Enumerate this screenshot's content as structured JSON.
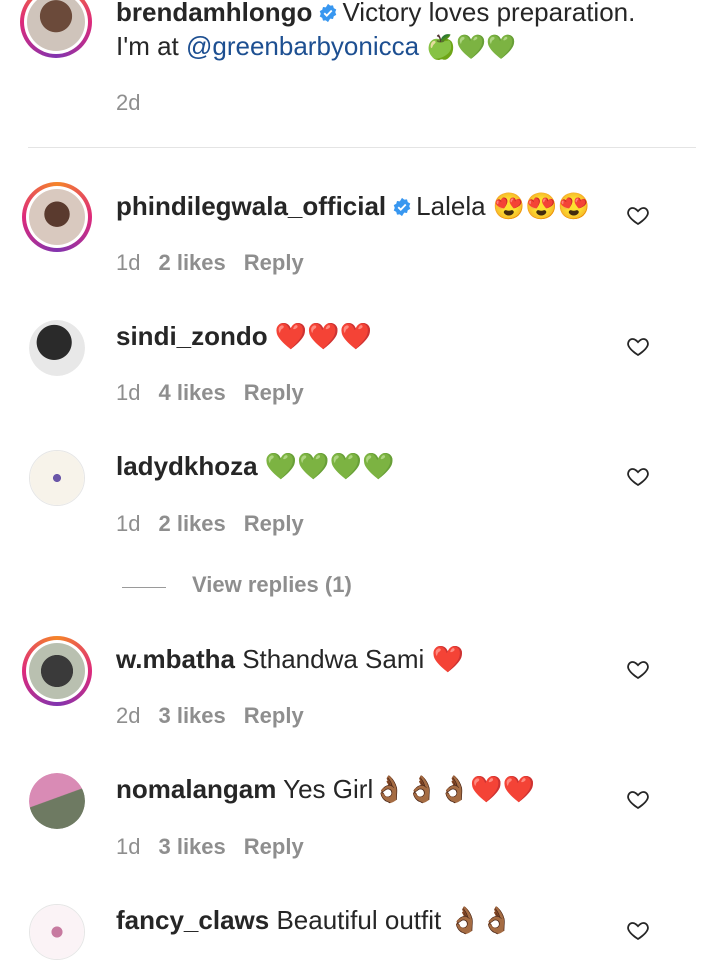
{
  "caption": {
    "username": "brendamhlongo",
    "text_line1": "Victory loves preparation.",
    "text_line2_prefix": "I'm at ",
    "mention": "@greenbarbyonicca",
    "emojis": "🍏💚💚",
    "time": "2d"
  },
  "comments": [
    {
      "username": "phindilegwala_official",
      "verified": true,
      "text": "Lalela 😍😍😍",
      "time": "1d",
      "likes": "2 likes",
      "reply": "Reply"
    },
    {
      "username": "sindi_zondo",
      "verified": false,
      "text": "❤️❤️❤️",
      "time": "1d",
      "likes": "4 likes",
      "reply": "Reply"
    },
    {
      "username": "ladydkhoza",
      "verified": false,
      "text": "💚💚💚💚",
      "time": "1d",
      "likes": "2 likes",
      "reply": "Reply"
    },
    {
      "username": "w.mbatha",
      "verified": false,
      "text": "Sthandwa Sami ❤️",
      "time": "2d",
      "likes": "3 likes",
      "reply": "Reply"
    },
    {
      "username": "nomalangam",
      "verified": false,
      "text": "Yes Girl👌🏾👌🏾👌🏾❤️❤️",
      "time": "1d",
      "likes": "3 likes",
      "reply": "Reply"
    },
    {
      "username": "fancy_claws",
      "verified": false,
      "text": "Beautiful outfit 👌🏾👌🏾",
      "time": "",
      "likes": "",
      "reply": ""
    }
  ],
  "view_replies": "View replies (1)",
  "colors": {
    "verified": "#3897f0",
    "mention": "#1d4f91",
    "meta": "#8e8e8e"
  }
}
